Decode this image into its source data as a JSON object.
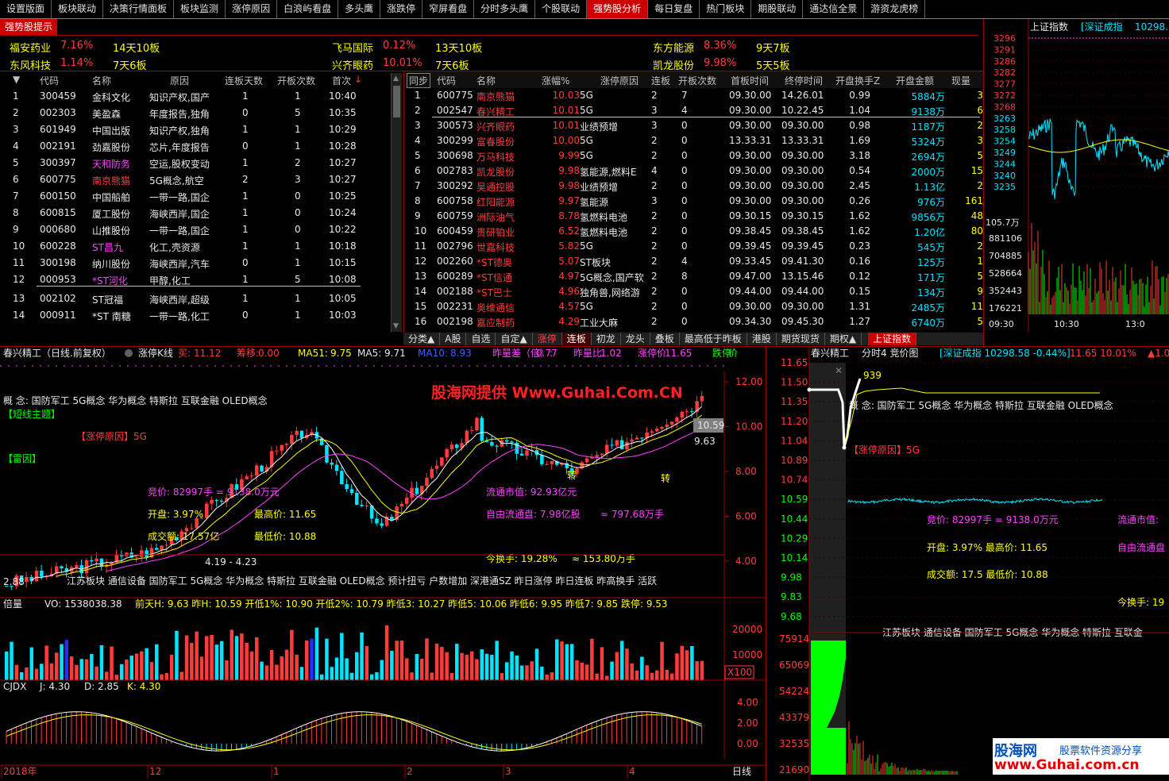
{
  "tabs": [
    "设置版面",
    "板块联动",
    "决策行情面板",
    "板块监测",
    "涨停原因",
    "白浪屿看盘",
    "多头鹰",
    "涨跌停",
    "窄屏看盘",
    "分时多头鹰",
    "个股联动",
    "强势股分析",
    "每日复盘",
    "热门板块",
    "期股联动",
    "通达信全景",
    "游资龙虎榜"
  ],
  "active_tab": "强势股分析",
  "panel_title": "强势股提示",
  "strong": [
    {
      "name": "福安药业",
      "pct": "7.16%",
      "board": "14天10板"
    },
    {
      "name": "东风科技",
      "pct": "1.14%",
      "board": "7天6板"
    },
    {
      "name": "飞马国际",
      "pct": "0.12%",
      "board": "13天10板"
    },
    {
      "name": "兴齐眼药",
      "pct": "10.01%",
      "board": "7天6板"
    },
    {
      "name": "东方能源",
      "pct": "8.36%",
      "board": "9天7板"
    },
    {
      "name": "凯龙股份",
      "pct": "9.98%",
      "board": "5天5板"
    }
  ],
  "left_table": {
    "headers": [
      "代码",
      "名称",
      "原因",
      "连板天数",
      "开板次数",
      "首次"
    ],
    "rows": [
      [
        "1",
        "300459",
        "金科文化",
        "知识产权,国产",
        "1",
        "1",
        "10:40"
      ],
      [
        "2",
        "002303",
        "美盈森",
        "年度报告,独角",
        "0",
        "5",
        "10:35"
      ],
      [
        "3",
        "601949",
        "中国出版",
        "知识产权,独角",
        "1",
        "1",
        "10:29"
      ],
      [
        "4",
        "002191",
        "劲嘉股份",
        "芯片,年度报告",
        "0",
        "1",
        "10:28"
      ],
      [
        "5",
        "300397",
        "天和防务",
        "空运,股权变动",
        "1",
        "2",
        "10:27"
      ],
      [
        "6",
        "600775",
        "南京熊猫",
        "5G概念,航空",
        "2",
        "3",
        "10:27"
      ],
      [
        "7",
        "600150",
        "中国船舶",
        "一带一路,国企",
        "1",
        "0",
        "10:25"
      ],
      [
        "8",
        "600815",
        "厦工股份",
        "海峡西岸,国企",
        "1",
        "0",
        "10:24"
      ],
      [
        "9",
        "000680",
        "山推股份",
        "一带一路,国企",
        "1",
        "0",
        "10:22"
      ],
      [
        "10",
        "600228",
        "ST昌九",
        "化工,壳资源",
        "1",
        "1",
        "10:18"
      ],
      [
        "11",
        "300198",
        "纳川股份",
        "海峡西岸,汽车",
        "0",
        "1",
        "10:15"
      ],
      [
        "12",
        "000953",
        "*ST河化",
        "甲醇,化工",
        "1",
        "5",
        "10:08"
      ],
      [
        "13",
        "002102",
        "ST冠福",
        "海峡西岸,超级",
        "1",
        "1",
        "10:05"
      ],
      [
        "14",
        "000911",
        "*ST 南糖",
        "一带一路,化工",
        "0",
        "1",
        "10:03"
      ]
    ]
  },
  "right_table": {
    "headers": [
      "同步",
      "代码",
      "名称",
      "涨幅%",
      "涨停原因",
      "连板",
      "开板次数",
      "首板时间",
      "终停时间",
      "开盘换手Z",
      "开盘金额",
      "现量"
    ],
    "rows": [
      [
        "1",
        "600775",
        "南京熊猫",
        "10.03",
        "5G",
        "2",
        "7",
        "09.30.00",
        "14.26.01",
        "0.99",
        "5884万",
        "3"
      ],
      [
        "2",
        "002547",
        "春兴精工",
        "10.01",
        "5G",
        "3",
        "4",
        "09.30.00",
        "10.22.45",
        "1.04",
        "9138万",
        "6"
      ],
      [
        "3",
        "300573",
        "兴齐眼药",
        "10.01",
        "业绩预增",
        "3",
        "0",
        "09.30.00",
        "09.30.00",
        "0.98",
        "1187万",
        "2"
      ],
      [
        "4",
        "300299",
        "富春股份",
        "10.00",
        "5G",
        "2",
        "0",
        "13.33.31",
        "13.33.31",
        "1.69",
        "5324万",
        "3"
      ],
      [
        "5",
        "300698",
        "万马科技",
        "9.99",
        "5G",
        "2",
        "0",
        "09.30.00",
        "09.30.00",
        "3.18",
        "2694万",
        "5"
      ],
      [
        "6",
        "002783",
        "凯龙股份",
        "9.98",
        "氢能源,燃料E",
        "4",
        "0",
        "09.30.00",
        "09.30.00",
        "0.54",
        "2000万",
        "15"
      ],
      [
        "7",
        "300292",
        "吴通控股",
        "9.98",
        "业绩预增",
        "2",
        "0",
        "09.30.00",
        "09.30.00",
        "2.45",
        "1.13亿",
        "2"
      ],
      [
        "8",
        "600758",
        "红阳能源",
        "9.97",
        "氢能源",
        "3",
        "0",
        "09.30.00",
        "09.30.00",
        "0.26",
        "976万",
        "161"
      ],
      [
        "9",
        "600759",
        "洲际油气",
        "8.78",
        "氢燃料电池",
        "2",
        "0",
        "09.30.15",
        "09.30.15",
        "1.62",
        "9856万",
        "48"
      ],
      [
        "10",
        "600459",
        "贵研铂业",
        "6.52",
        "氢燃料电池",
        "2",
        "0",
        "09.38.45",
        "09.38.45",
        "1.62",
        "1.20亿",
        "80"
      ],
      [
        "11",
        "002796",
        "世嘉科技",
        "5.82",
        "5G",
        "2",
        "0",
        "09.39.45",
        "09.39.45",
        "0.23",
        "545万",
        "2"
      ],
      [
        "12",
        "002260",
        "*ST德奥",
        "5.07",
        "ST板块",
        "2",
        "4",
        "09.33.45",
        "09.41.30",
        "0.16",
        "125万",
        "1"
      ],
      [
        "13",
        "600289",
        "*ST信通",
        "4.97",
        "5G概念,国产软",
        "2",
        "8",
        "09.47.00",
        "13.15.46",
        "0.12",
        "171万",
        "5"
      ],
      [
        "14",
        "002188",
        "*ST巴士",
        "4.96",
        "独角兽,网络游",
        "2",
        "0",
        "09.44.00",
        "09.44.00",
        "0.15",
        "134万",
        "9"
      ],
      [
        "15",
        "002231",
        "奥维通信",
        "4.57",
        "5G",
        "2",
        "0",
        "09.30.00",
        "09.30.00",
        "1.31",
        "2485万",
        "11"
      ],
      [
        "16",
        "002198",
        "嘉应制药",
        "4.29",
        "工业大麻",
        "2",
        "0",
        "09.34.30",
        "09.45.30",
        "1.27",
        "6740万",
        "5"
      ]
    ]
  },
  "bottom_tabs": [
    "分类▲",
    "A股",
    "自选",
    "自定▲",
    "涨停",
    "连板",
    "初龙",
    "龙头",
    "叠板",
    "最高低于昨板",
    "港股",
    "期货现货",
    "期权▲",
    "上证指数"
  ],
  "index_panel": {
    "name": "上证指数",
    "sz_label": "[深证成指",
    "sz_value": "10298.5",
    "prices": [
      "3296",
      "3291",
      "3286",
      "3282",
      "3277",
      "3272",
      "3268",
      "3263",
      "3258",
      "3254",
      "3249",
      "3244",
      "3240",
      "3235"
    ],
    "vol_label": "105.7万",
    "vols": [
      "881106",
      "704885",
      "528664",
      "352443",
      "176221"
    ],
    "times": [
      "09:30",
      "10:30",
      "13:0"
    ]
  },
  "kline": {
    "title": "春兴精工（日线.前复权）",
    "indicator": "涨停K线",
    "params": [
      [
        "买:",
        "11.12"
      ],
      [
        "筹移:",
        "0.00"
      ],
      [
        "MA51:",
        "9.75"
      ],
      [
        "MA5:",
        "9.71"
      ],
      [
        "MA10:",
        "8.93"
      ],
      [
        "昨量差（倍）:",
        "0.77"
      ],
      [
        "昨量比:",
        "1.02"
      ],
      [
        "涨停价:",
        "11.65"
      ],
      [
        "跌停",
        "价"
      ]
    ],
    "concept": "概 念: 国防军工 5G概念 华为概念 特斯拉 互联金融 OLED概念",
    "short_theme": "【短线主题】",
    "reason": "【涨停原因】5G",
    "leiyin": "【雷因】",
    "watermark": "股海网提供 Www.Guhai.Com.CN",
    "bid": "竞价: 82997手 = 9138.0万元",
    "open": "开盘: 3.97%",
    "high": "最高价: 11.65",
    "amount": "成交额: 17.57亿",
    "low": "最低价: 10.88",
    "mcap": "流通市值: 92.93亿元",
    "free": "自由流通盘: 7.98亿股",
    "free2": "≈  797.68万手",
    "turnover": "今换手: 19.28%",
    "turn2": "≈   153.80万手",
    "range": "4.19 - 4.23",
    "first": "2.88",
    "axis": [
      "12.00",
      "10.00",
      "8.00",
      "6.00",
      "4.00"
    ],
    "right_tags": [
      "10.59",
      "9.63"
    ],
    "tags_row": "江苏板块  通信设备  国防军工  5G概念  华为概念  特斯拉  互联金融  OLED概念   预计扭亏  户数增加  深港通SZ  昨日涨停  昨日连板  昨高换手  活跃",
    "zhuan": "转"
  },
  "volume": {
    "label": "倍量",
    "vo": "VO: 1538038.38",
    "params": "前天H: 9.63 昨H: 10.59 开低1%: 10.90 开低2%: 10.79 昨低3: 10.27 昨低5: 10.06 昨低6: 9.95 昨低7: 9.85 跌停: 9.53",
    "axis": [
      "20000",
      "10000"
    ],
    "x100": "X100"
  },
  "cjdx": {
    "label": "CJDX",
    "j": "J: 4.30",
    "d": "D: 2.85",
    "k": "K: 4.30",
    "axis": [
      "4.00",
      "2.00",
      "0.00"
    ]
  },
  "xaxis": {
    "labels": [
      "2018年",
      "12",
      "1",
      "2",
      "3",
      "4"
    ],
    "period": "日线"
  },
  "tick": {
    "title": "春兴精工",
    "sub": "分时4 竞价图",
    "sz": "[深证成指 10298.58 -0.44%]",
    "price": "11.65 10.01%",
    "vol": "▲1.06",
    "axis": [
      "11.65",
      "11.50",
      "11.35",
      "11.20",
      "11.04",
      "10.89",
      "10.74",
      "10.59",
      "10.44",
      "10.29",
      "10.14",
      "9.98",
      "9.83",
      "9.68"
    ],
    "concept": "概 念: 国防军工 5G概念 华为概念 特斯拉 互联金融 OLED概念",
    "reason": "【涨停原因】5G",
    "bid": "竞价: 82997手 = 9138.0万元",
    "mcap": "流通市值:",
    "open": "开盘: 3.97% 最高价: 11.65",
    "free": "自由流通盘",
    "amount": "成交额: 17.5 最低价: 10.88",
    "turnover": "今换手: 19",
    "tags": "江苏板块  通信设备  国防军工  5G概念  华为概念  特斯拉  互联金",
    "vaxis": [
      "75914",
      "65069",
      "54224",
      "43379",
      "32535",
      "21690",
      "10845"
    ],
    "mark": "939"
  },
  "logo": {
    "title": "股海网",
    "sub": "股票软件资源分享",
    "url": "www.Guhai.com.cn"
  }
}
